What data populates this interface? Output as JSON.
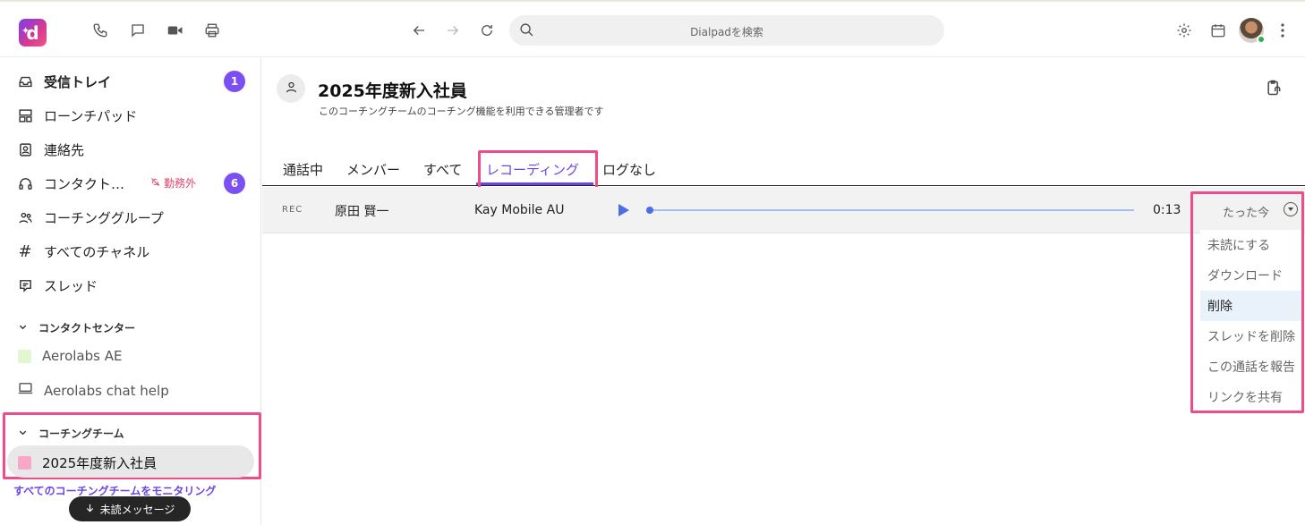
{
  "topbar": {
    "logo_letter": "d",
    "search_placeholder": "Dialpadを検索"
  },
  "sidebar": {
    "items": [
      {
        "label": "受信トレイ",
        "icon": "inbox-icon",
        "badge": "1"
      },
      {
        "label": "ローンチパッド",
        "icon": "launchpad-icon"
      },
      {
        "label": "連絡先",
        "icon": "contacts-icon"
      },
      {
        "label": "コンタクト…",
        "icon": "headset-icon",
        "badge": "6",
        "status": "勤務外"
      },
      {
        "label": "コーチンググループ",
        "icon": "group-icon"
      },
      {
        "label": "すべてのチャネル",
        "icon": "hash-icon"
      },
      {
        "label": "スレッド",
        "icon": "thread-icon"
      }
    ],
    "contact_center": {
      "title": "コンタクトセンター",
      "items": [
        {
          "label": "Aerolabs AE",
          "color": "#e3f6d2"
        },
        {
          "label": "Aerolabs chat help",
          "icon": "monitor-icon"
        }
      ]
    },
    "coaching_team": {
      "title": "コーチングチーム",
      "items": [
        {
          "label": "2025年度新入社員",
          "color": "#f7a8c8"
        }
      ]
    },
    "monitor_link": "すべてのコーチングチームをモニタリング",
    "unread_pill": "未読メッセージ"
  },
  "main": {
    "title": "2025年度新入社員",
    "subtitle": "このコーチングチームのコーチング機能を利用できる管理者です",
    "tabs": [
      {
        "label": "通話中"
      },
      {
        "label": "メンバー"
      },
      {
        "label": "すべて"
      },
      {
        "label": "レコーディング",
        "active": true
      },
      {
        "label": "ログなし"
      }
    ],
    "recording": {
      "tag": "REC",
      "name": "原田 賢一",
      "line": "Kay Mobile AU",
      "duration": "0:13",
      "time_ago": "たった今",
      "progress": 0
    },
    "menu": [
      {
        "label": "未読にする"
      },
      {
        "label": "ダウンロード"
      },
      {
        "label": "削除",
        "hover": true
      },
      {
        "label": "スレッドを削除"
      },
      {
        "label": "この通話を報告"
      },
      {
        "label": "リンクを共有"
      }
    ]
  },
  "colors": {
    "accent": "#6b46e5",
    "highlight": "#ee4d8a",
    "badge": "#7b4ff2"
  }
}
